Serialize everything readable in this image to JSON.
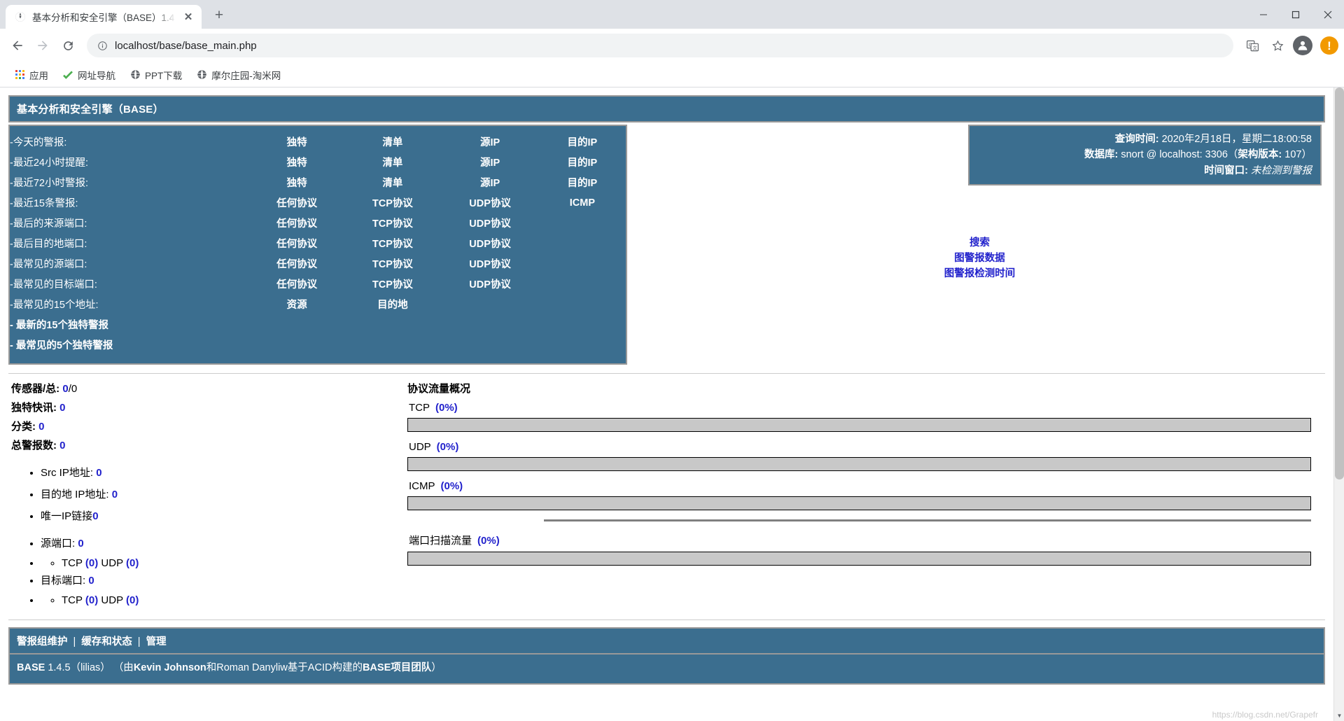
{
  "browser": {
    "tab": {
      "title": "基本分析和安全引擎（BASE）1.4",
      "favicon": "globe-icon",
      "close": "✕"
    },
    "newtab_label": "+",
    "window_controls": {
      "minimize": "minimize-icon",
      "maximize": "maximize-icon",
      "close": "close-icon"
    },
    "nav": {
      "back": "back-arrow-icon",
      "forward": "forward-arrow-icon",
      "reload": "reload-icon"
    },
    "omnibox": {
      "info_icon": "info-circle-icon",
      "url": "localhost/base/base_main.php"
    },
    "toolbar_right": {
      "translate": "translate-icon",
      "bookmark": "star-icon",
      "profile": "avatar-icon",
      "update": "!"
    },
    "bookmarks": [
      {
        "label": "应用",
        "icon": "apps-grid-icon"
      },
      {
        "label": "网址导航",
        "icon": "check-icon"
      },
      {
        "label": "PPT下载",
        "icon": "globe-icon"
      },
      {
        "label": "摩尔庄园-淘米网",
        "icon": "globe-icon"
      }
    ]
  },
  "app": {
    "header_title": "基本分析和安全引擎（BASE）",
    "menu_rows": [
      {
        "label": "-今天的警报:",
        "cols": [
          "独特",
          "清单",
          "源IP",
          "目的IP"
        ]
      },
      {
        "label": "-最近24小时提醒:",
        "cols": [
          "独特",
          "清单",
          "源IP",
          "目的IP"
        ]
      },
      {
        "label": "-最近72小时警报:",
        "cols": [
          "独特",
          "清单",
          "源IP",
          "目的IP"
        ]
      },
      {
        "label": "-最近15条警报:",
        "cols": [
          "任何协议",
          "TCP协议",
          "UDP协议",
          "ICMP"
        ]
      },
      {
        "label": "-最后的来源端口:",
        "cols": [
          "任何协议",
          "TCP协议",
          "UDP协议",
          ""
        ]
      },
      {
        "label": "-最后目的地端口:",
        "cols": [
          "任何协议",
          "TCP协议",
          "UDP协议",
          ""
        ]
      },
      {
        "label": "-最常见的源端口:",
        "cols": [
          "任何协议",
          "TCP协议",
          "UDP协议",
          ""
        ]
      },
      {
        "label": "-最常见的目标端口:",
        "cols": [
          "任何协议",
          "TCP协议",
          "UDP协议",
          ""
        ]
      },
      {
        "label": "-最常见的15个地址:",
        "cols": [
          "资源",
          "目的地",
          "",
          ""
        ]
      }
    ],
    "menu_bold_rows": [
      "- 最新的15个独特警报",
      "- 最常见的5个独特警报"
    ],
    "info_box": {
      "query_time_label": "查询时间:",
      "query_time_value": "2020年2月18日，星期二18:00:58",
      "database_label": "数据库:",
      "database_value": "snort @ localhost: 3306（",
      "schema_label": "架构版本:",
      "schema_value": "107）",
      "time_window_label": "时间窗口:",
      "time_window_value": "未检测到警报"
    },
    "quick_links": [
      "搜索",
      "图警报数据",
      "图警报检测时间"
    ],
    "stats": [
      {
        "label": "传感器/总:",
        "value": "0",
        "suffix": "/0"
      },
      {
        "label": "独特快讯:",
        "value": "0",
        "suffix": ""
      },
      {
        "label": "分类:",
        "value": "0",
        "suffix": ""
      },
      {
        "label": "总警报数:",
        "value": "0",
        "suffix": ""
      }
    ],
    "bullets": {
      "src_ip_label": "Src IP地址:",
      "src_ip_value": "0",
      "dst_ip_label": "目的地 IP地址:",
      "dst_ip_value": "0",
      "unique_ip_label": "唯一IP链接",
      "unique_ip_value": "0",
      "src_port_label": "源端口:",
      "src_port_value": "0",
      "src_port_tcp_label": "TCP",
      "src_port_tcp_value": "(0)",
      "src_port_udp_label": "UDP",
      "src_port_udp_value": "(0)",
      "dst_port_label": "目标端口:",
      "dst_port_value": "0",
      "dst_port_tcp_label": "TCP",
      "dst_port_tcp_value": "(0)",
      "dst_port_udp_label": "UDP",
      "dst_port_udp_value": "(0)"
    },
    "protocol": {
      "title": "协议流量概况",
      "items": [
        {
          "name": "TCP",
          "pct": "(0%)",
          "value": 0
        },
        {
          "name": "UDP",
          "pct": "(0%)",
          "value": 0
        },
        {
          "name": "ICMP",
          "pct": "(0%)",
          "value": 0
        },
        {
          "name": "端口扫描流量",
          "pct": "(0%)",
          "value": 0
        }
      ]
    },
    "footer": {
      "links": [
        "警报组维护",
        "缓存和状态",
        "管理"
      ],
      "divider": "|",
      "credit_name": "BASE",
      "credit_version": "1.4.5（lilias）",
      "credit_text_1": "（由",
      "credit_author_1": "Kevin Johnson",
      "credit_mid": "和",
      "credit_author_2": "Roman Danyliw",
      "credit_text_2": "基于ACID构建的",
      "credit_bold_tail": "BASE项目团队",
      "credit_close": "）"
    }
  },
  "watermark": "https://blog.csdn.net/Grapefr",
  "colors": {
    "base_blue": "#3b6e8f",
    "link_blue": "#2222cc",
    "bar_gray": "#c8c8c8",
    "border_gray": "#999999"
  }
}
